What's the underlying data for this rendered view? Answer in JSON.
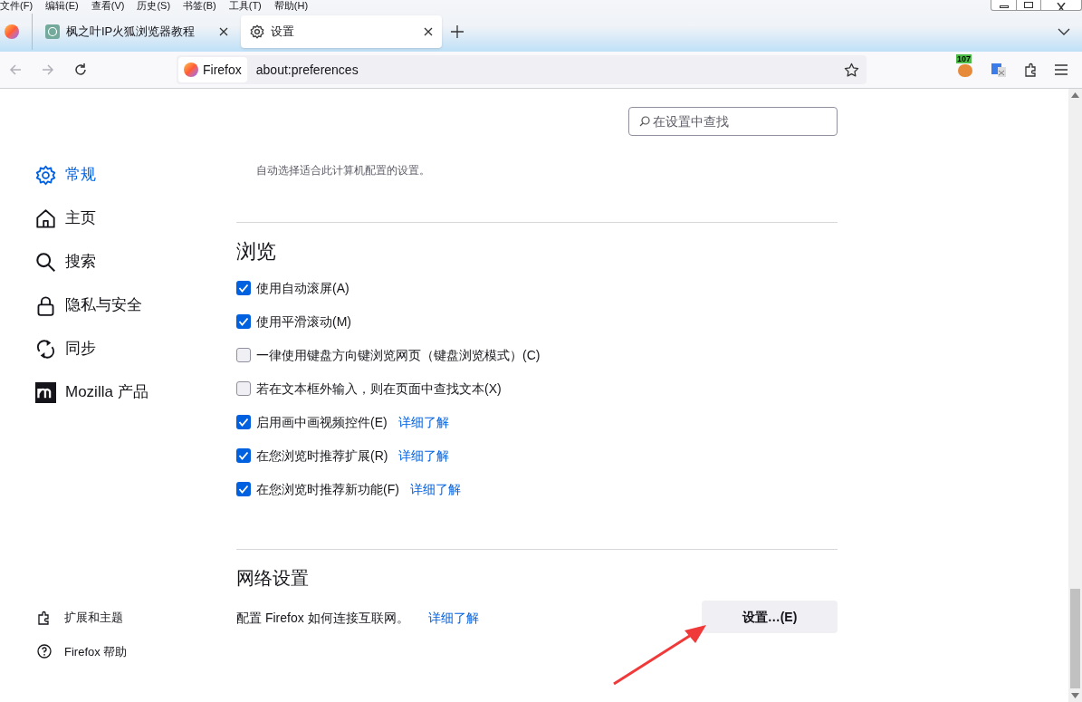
{
  "menu_bar": [
    "文件(F)",
    "编辑(E)",
    "查看(V)",
    "历史(S)",
    "书签(B)",
    "工具(T)",
    "帮助(H)"
  ],
  "tabs": [
    {
      "title": "枫之叶IP火狐浏览器教程",
      "selected": false
    },
    {
      "title": "设置",
      "selected": true
    }
  ],
  "address_bar": {
    "identity": "Firefox",
    "url": "about:preferences"
  },
  "toolbar": {
    "badge": "107"
  },
  "search": {
    "placeholder": "在设置中查找"
  },
  "sidebar": {
    "items": [
      {
        "label": "常规",
        "selected": true
      },
      {
        "label": "主页",
        "selected": false
      },
      {
        "label": "搜索",
        "selected": false
      },
      {
        "label": "隐私与安全",
        "selected": false
      },
      {
        "label": "同步",
        "selected": false
      },
      {
        "label": "Mozilla 产品",
        "selected": false
      }
    ],
    "footer": [
      {
        "label": "扩展和主题"
      },
      {
        "label": "Firefox 帮助"
      }
    ]
  },
  "intro_text": "自动选择适合此计算机配置的设置。",
  "browsing": {
    "heading": "浏览",
    "options": [
      {
        "label": "使用自动滚屏(A)",
        "checked": true
      },
      {
        "label": "使用平滑滚动(M)",
        "checked": true
      },
      {
        "label": "一律使用键盘方向键浏览网页（键盘浏览模式）(C)",
        "checked": false
      },
      {
        "label": "若在文本框外输入，则在页面中查找文本(X)",
        "checked": false
      },
      {
        "label": "启用画中画视频控件(E)",
        "checked": true,
        "link": "详细了解"
      },
      {
        "label": "在您浏览时推荐扩展(R)",
        "checked": true,
        "link": "详细了解"
      },
      {
        "label": "在您浏览时推荐新功能(F)",
        "checked": true,
        "link": "详细了解"
      }
    ]
  },
  "network": {
    "heading": "网络设置",
    "description": "配置 Firefox 如何连接互联网。",
    "link": "详细了解",
    "button": "设置…(E)"
  }
}
